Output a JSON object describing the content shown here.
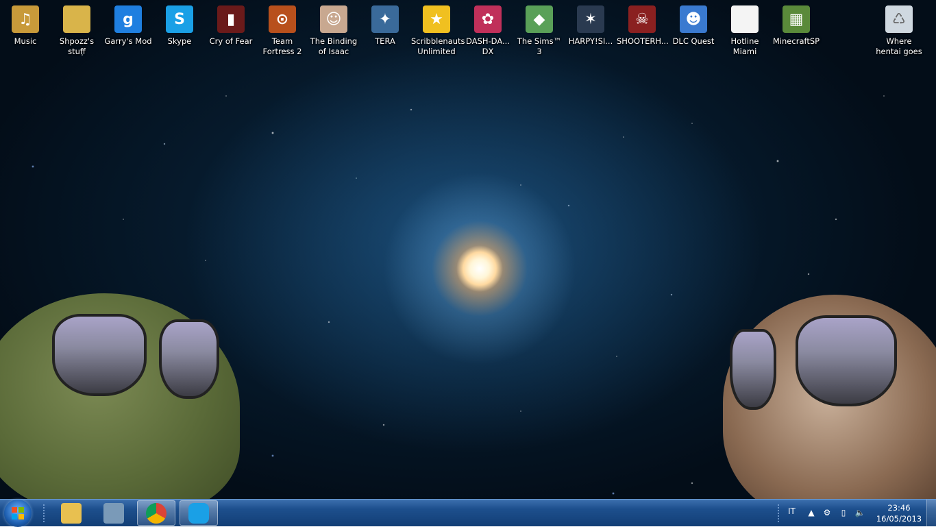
{
  "desktop_icons": [
    {
      "label": "Music",
      "icon": "music-folder-icon",
      "color": "#c89a3a",
      "glyph": "♫",
      "shortcut": false
    },
    {
      "label": "Shpozz's stuff",
      "icon": "folder-icon",
      "color": "#d9b44a",
      "glyph": "",
      "shortcut": false
    },
    {
      "label": "Garry's Mod",
      "icon": "garrys-mod-icon",
      "color": "#1f7fe0",
      "glyph": "g",
      "shortcut": true
    },
    {
      "label": "Skype",
      "icon": "skype-icon",
      "color": "#1aa0e6",
      "glyph": "S",
      "shortcut": true
    },
    {
      "label": "Cry of Fear",
      "icon": "cry-of-fear-icon",
      "color": "#6a1a1a",
      "glyph": "▮",
      "shortcut": true
    },
    {
      "label": "Team Fortress 2",
      "icon": "team-fortress-2-icon",
      "color": "#b8501c",
      "glyph": "⊙",
      "shortcut": true
    },
    {
      "label": "The Binding of Isaac",
      "icon": "binding-of-isaac-icon",
      "color": "#c8a890",
      "glyph": "☺",
      "shortcut": true
    },
    {
      "label": "TERA",
      "icon": "tera-icon",
      "color": "#3a6a9a",
      "glyph": "✦",
      "shortcut": true
    },
    {
      "label": "Scribblenauts Unlimited",
      "icon": "scribblenauts-icon",
      "color": "#f0c020",
      "glyph": "★",
      "shortcut": true
    },
    {
      "label": "DASH-DA... DX",
      "icon": "dash-da-dx-icon",
      "color": "#c0305a",
      "glyph": "✿",
      "shortcut": true
    },
    {
      "label": "The Sims™ 3",
      "icon": "sims-3-icon",
      "color": "#5aa058",
      "glyph": "◆",
      "shortcut": true
    },
    {
      "label": "HARPY!SI...",
      "icon": "harpy-icon",
      "color": "#2a3a50",
      "glyph": "✶",
      "shortcut": true
    },
    {
      "label": "SHOOTERH...",
      "icon": "shooterh-icon",
      "color": "#8a2020",
      "glyph": "☠",
      "shortcut": true
    },
    {
      "label": "DLC Quest",
      "icon": "dlc-quest-icon",
      "color": "#3a7ad0",
      "glyph": "☻",
      "shortcut": true
    },
    {
      "label": "Hotline Miami",
      "icon": "document-icon",
      "color": "#f4f4f4",
      "glyph": "",
      "shortcut": true
    },
    {
      "label": "MinecraftSP",
      "icon": "minecraft-icon",
      "color": "#5a8a3a",
      "glyph": "▦",
      "shortcut": false
    },
    {
      "label": "Where hentai goes",
      "icon": "recycle-bin-icon",
      "color": "#cfd8e0",
      "glyph": "♺",
      "shortcut": false
    }
  ],
  "taskbar": {
    "pinned": [
      {
        "name": "file-explorer",
        "icon": "folder-icon",
        "color": "#e8c050",
        "active": false
      },
      {
        "name": "computer",
        "icon": "computer-icon",
        "color": "#7a9ab8",
        "active": false
      },
      {
        "name": "chrome",
        "icon": "chrome-icon",
        "color": "#e04a3a",
        "active": true
      },
      {
        "name": "skype",
        "icon": "skype-icon",
        "color": "#1aa0e6",
        "active": true
      }
    ],
    "language": "IT",
    "clock": {
      "time": "23:46",
      "date": "16/05/2013"
    }
  },
  "colors": {
    "taskbar": "#1d4f8d",
    "accent": "#3c6fae"
  }
}
